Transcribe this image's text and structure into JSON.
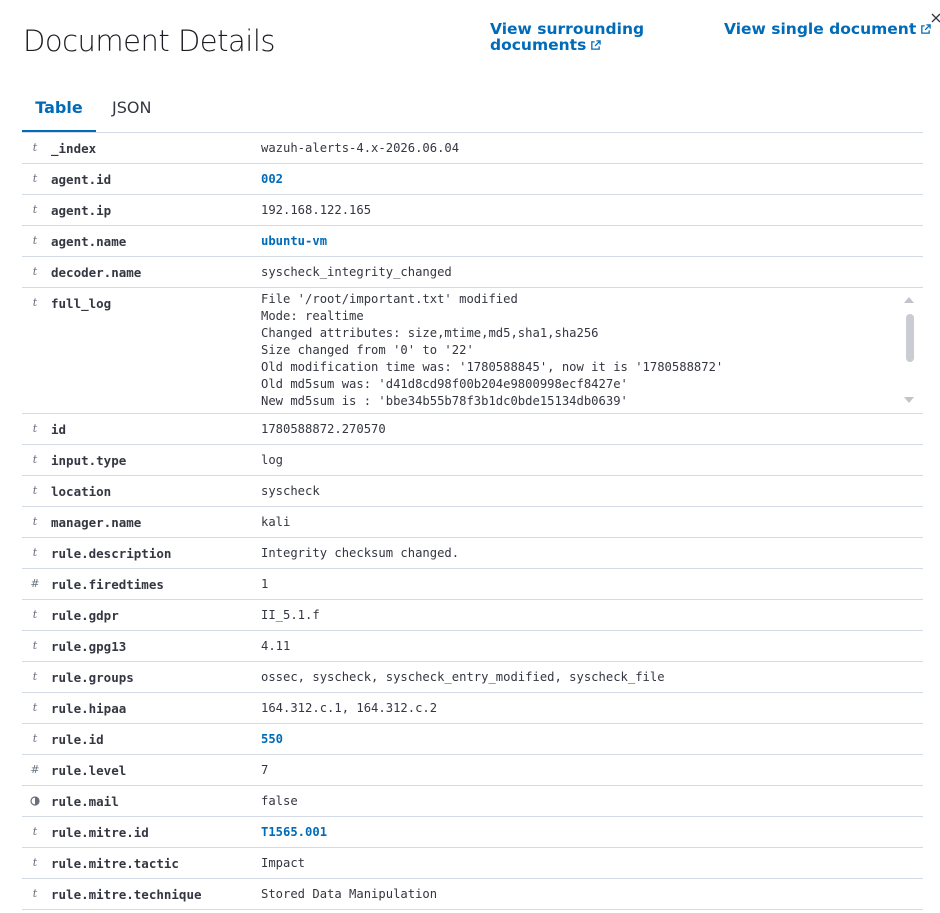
{
  "header": {
    "title": "Document Details",
    "view_surrounding": "View surrounding documents",
    "view_single": "View single document"
  },
  "tabs": [
    {
      "label": "Table",
      "active": true
    },
    {
      "label": "JSON",
      "active": false
    }
  ],
  "fields": [
    {
      "type": "string",
      "name": "_index",
      "value": "wazuh-alerts-4.x-2026.06.04",
      "link": false
    },
    {
      "type": "string",
      "name": "agent.id",
      "value": "002",
      "link": true
    },
    {
      "type": "string",
      "name": "agent.ip",
      "value": "192.168.122.165",
      "link": false
    },
    {
      "type": "string",
      "name": "agent.name",
      "value": "ubuntu-vm",
      "link": true
    },
    {
      "type": "string",
      "name": "decoder.name",
      "value": "syscheck_integrity_changed",
      "link": false
    },
    {
      "type": "string",
      "name": "full_log",
      "value": "File '/root/important.txt' modified\nMode: realtime\nChanged attributes: size,mtime,md5,sha1,sha256\nSize changed from '0' to '22'\nOld modification time was: '1780588845', now it is '1780588872'\nOld md5sum was: 'd41d8cd98f00b204e9800998ecf8427e'\nNew md5sum is : 'bbe34b55b78f3b1dc0bde15134db0639'",
      "link": false,
      "multiline": true
    },
    {
      "type": "string",
      "name": "id",
      "value": "1780588872.270570",
      "link": false
    },
    {
      "type": "string",
      "name": "input.type",
      "value": "log",
      "link": false
    },
    {
      "type": "string",
      "name": "location",
      "value": "syscheck",
      "link": false
    },
    {
      "type": "string",
      "name": "manager.name",
      "value": "kali",
      "link": false
    },
    {
      "type": "string",
      "name": "rule.description",
      "value": "Integrity checksum changed.",
      "link": false
    },
    {
      "type": "number",
      "name": "rule.firedtimes",
      "value": "1",
      "link": false
    },
    {
      "type": "string",
      "name": "rule.gdpr",
      "value": "II_5.1.f",
      "link": false
    },
    {
      "type": "string",
      "name": "rule.gpg13",
      "value": "4.11",
      "link": false
    },
    {
      "type": "string",
      "name": "rule.groups",
      "value": "ossec, syscheck, syscheck_entry_modified, syscheck_file",
      "link": false
    },
    {
      "type": "string",
      "name": "rule.hipaa",
      "value": "164.312.c.1, 164.312.c.2",
      "link": false
    },
    {
      "type": "string",
      "name": "rule.id",
      "value": "550",
      "link": true
    },
    {
      "type": "number",
      "name": "rule.level",
      "value": "7",
      "link": false
    },
    {
      "type": "boolean",
      "name": "rule.mail",
      "value": "false",
      "link": false
    },
    {
      "type": "string",
      "name": "rule.mitre.id",
      "value": "T1565.001",
      "link": true
    },
    {
      "type": "string",
      "name": "rule.mitre.tactic",
      "value": "Impact",
      "link": false
    },
    {
      "type": "string",
      "name": "rule.mitre.technique",
      "value": "Stored Data Manipulation",
      "link": false
    }
  ],
  "icons": {
    "close": "close-icon",
    "external": "external-link-icon",
    "string_type": "string-type-icon",
    "number_type": "number-type-icon",
    "boolean_type": "boolean-type-icon"
  },
  "colors": {
    "accent": "#006bb8",
    "text": "#343741",
    "border": "#d3dae6",
    "type_icon": "#69707d"
  }
}
